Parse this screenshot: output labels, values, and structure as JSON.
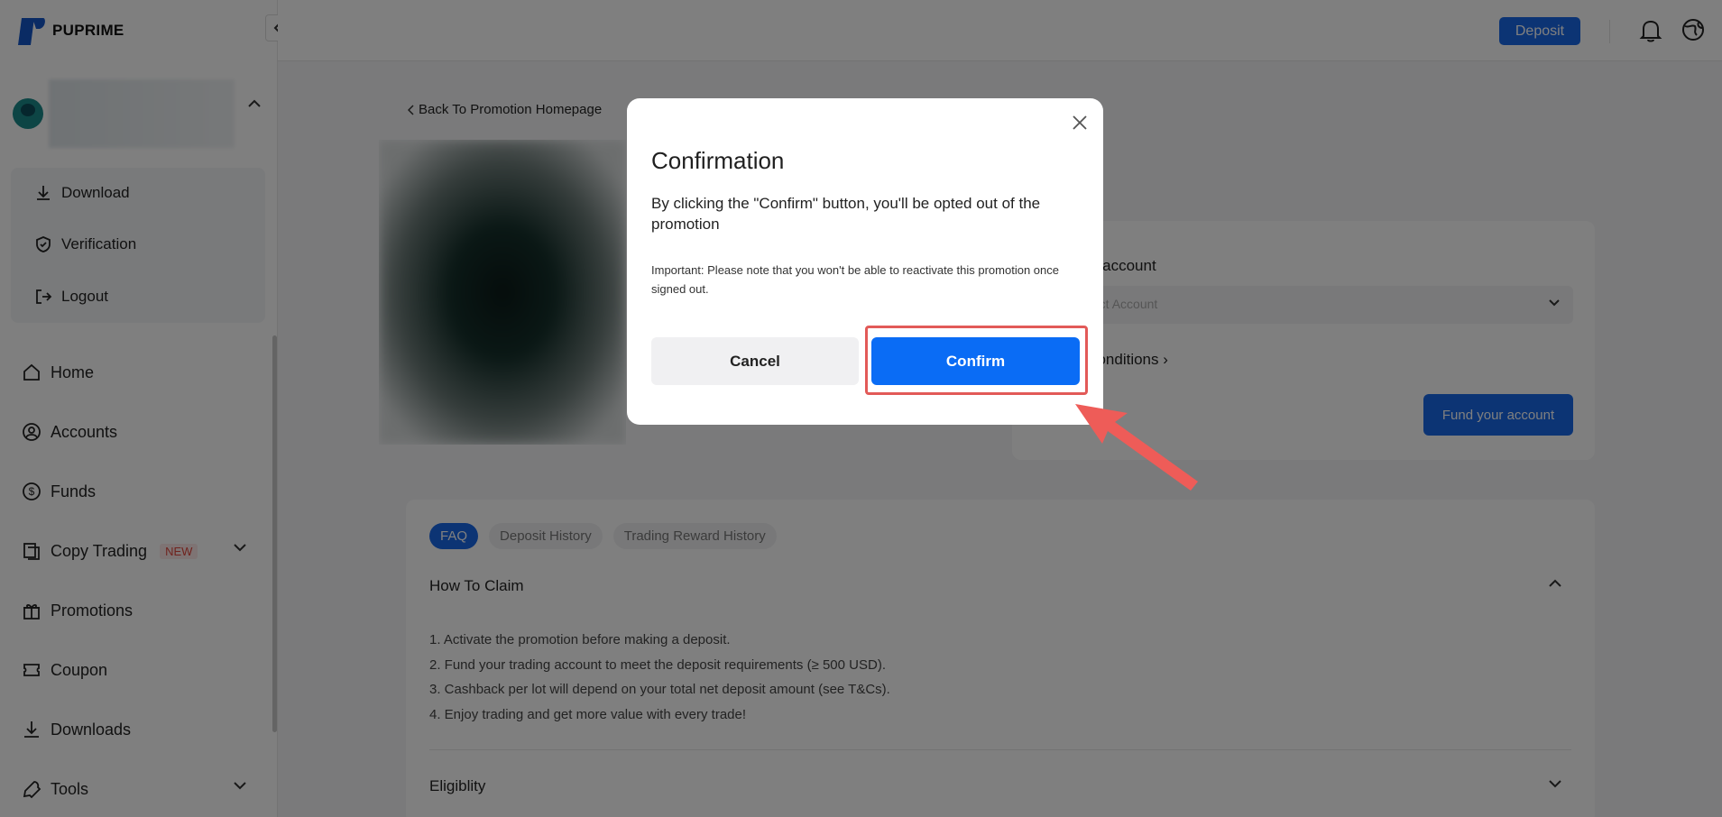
{
  "brand": {
    "name": "PUPRIME"
  },
  "sidebar": {
    "profile_menu": [
      {
        "label": "Download",
        "icon": "download-icon"
      },
      {
        "label": "Verification",
        "icon": "shield-icon"
      },
      {
        "label": "Logout",
        "icon": "logout-icon"
      }
    ],
    "nav": [
      {
        "label": "Home",
        "icon": "home-icon"
      },
      {
        "label": "Accounts",
        "icon": "user-circle-icon"
      },
      {
        "label": "Funds",
        "icon": "dollar-icon"
      },
      {
        "label": "Copy Trading",
        "icon": "copy-icon",
        "badge": "NEW"
      },
      {
        "label": "Promotions",
        "icon": "gift-icon"
      },
      {
        "label": "Coupon",
        "icon": "coupon-icon"
      },
      {
        "label": "Downloads",
        "icon": "download-icon"
      },
      {
        "label": "Tools",
        "icon": "wrench-icon"
      }
    ]
  },
  "topbar": {
    "deposit_label": "Deposit"
  },
  "main": {
    "back_link": "Back To Promotion Homepage",
    "trading_account_label": "ting account",
    "select_placeholder": "elect Account",
    "terms_link": "d Conditions",
    "fund_button": "Fund your account",
    "tabs": [
      "FAQ",
      "Deposit History",
      "Trading Reward History"
    ],
    "faq": {
      "how_to_claim": "How To Claim",
      "steps": [
        "1. Activate the promotion before making a deposit.",
        "2. Fund your trading account to meet the deposit requirements  (≥ 500 USD).",
        "3. Cashback per lot will depend on your total net deposit amount (see T&Cs).",
        "4. Enjoy trading and get more value with every trade!"
      ],
      "eligibility": "Eligiblity"
    }
  },
  "modal": {
    "title": "Confirmation",
    "body": "By clicking the \"Confirm\" button, you'll be opted out of the promotion",
    "note": "Important: Please note that you won't be able to reactivate this promotion once signed out.",
    "cancel": "Cancel",
    "confirm": "Confirm"
  },
  "colors": {
    "accent": "#0a6cf5",
    "highlight": "#e25a58",
    "arrow": "#ee5c58"
  }
}
